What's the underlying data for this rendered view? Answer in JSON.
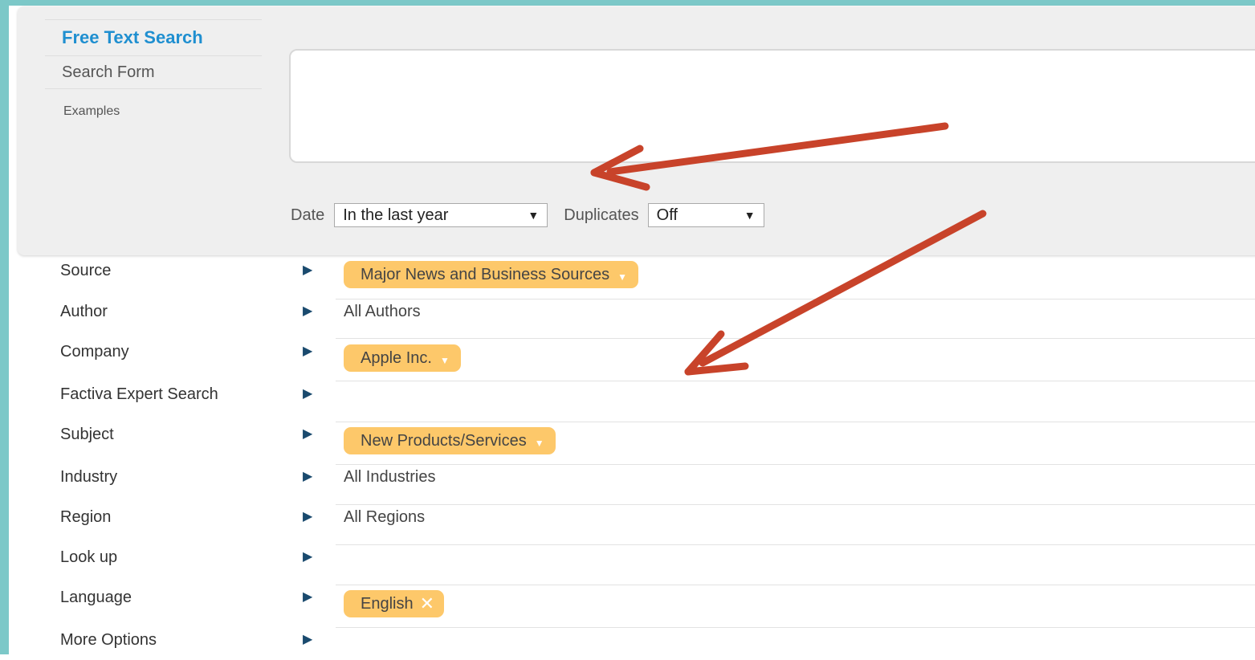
{
  "nav": {
    "free_text_search": "Free Text Search",
    "search_form": "Search Form",
    "examples": "Examples"
  },
  "filters": {
    "date_label": "Date",
    "date_value": "In the last year",
    "duplicates_label": "Duplicates",
    "duplicates_value": "Off"
  },
  "facets": [
    {
      "label": "Source",
      "value": "Major News and Business Sources",
      "kind": "pill-dropdown"
    },
    {
      "label": "Author",
      "value": "All Authors",
      "kind": "plain"
    },
    {
      "label": "Company",
      "value": "Apple Inc.",
      "kind": "pill-dropdown"
    },
    {
      "label": "Factiva Expert Search",
      "value": "",
      "kind": "empty"
    },
    {
      "label": "Subject",
      "value": "New Products/Services",
      "kind": "pill-dropdown"
    },
    {
      "label": "Industry",
      "value": "All Industries",
      "kind": "plain"
    },
    {
      "label": "Region",
      "value": "All Regions",
      "kind": "plain"
    },
    {
      "label": "Look up",
      "value": "",
      "kind": "empty"
    },
    {
      "label": "Language",
      "value": "English",
      "kind": "pill-remove"
    },
    {
      "label": "More Options",
      "value": "",
      "kind": "empty"
    }
  ],
  "colors": {
    "frame": "#7cc8c8",
    "accent_blue": "#1f8fd0",
    "pill": "#fdc86a",
    "annotation_arrow": "#c8432a"
  },
  "icons": {
    "facet_expander": "triangle-right-icon",
    "dropdown": "caret-down-icon",
    "remove": "close-icon"
  }
}
